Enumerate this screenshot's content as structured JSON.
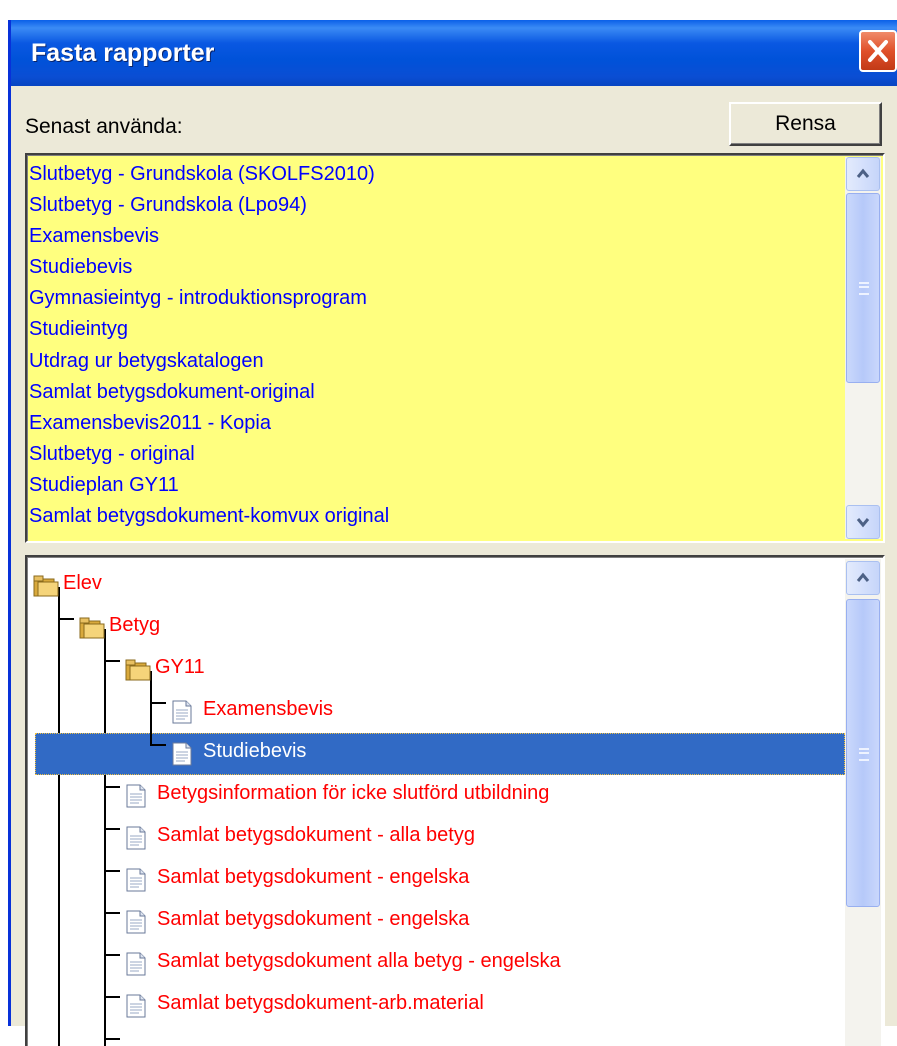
{
  "window": {
    "title": "Fasta rapporter",
    "close_icon": "close-icon"
  },
  "recent": {
    "label": "Senast använda:",
    "clear_button": "Rensa",
    "background": "#ffff7f",
    "text_color": "#0000ff",
    "items": [
      "Slutbetyg - Grundskola (SKOLFS2010)",
      "Slutbetyg - Grundskola (Lpo94)",
      "Examensbevis",
      "Studiebevis",
      "Gymnasieintyg - introduktionsprogram",
      "Studieintyg",
      "Utdrag ur betygskatalogen",
      "Samlat betygsdokument-original",
      "Examensbevis2011 - Kopia",
      "Slutbetyg - original",
      "Studieplan GY11",
      "Samlat betygsdokument-komvux original"
    ]
  },
  "tree": {
    "text_color": "#ff0000",
    "selected_background": "#316ac5",
    "nodes": [
      {
        "label": "Elev",
        "icon": "folder-icon"
      },
      {
        "label": "Betyg",
        "icon": "folder-icon"
      },
      {
        "label": "GY11",
        "icon": "folder-icon"
      },
      {
        "label": "Examensbevis",
        "icon": "document-icon"
      },
      {
        "label": "Studiebevis",
        "icon": "document-icon",
        "selected": true
      },
      {
        "label": "Betygsinformation för icke slutförd utbildning",
        "icon": "document-icon"
      },
      {
        "label": "Samlat betygsdokument - alla betyg",
        "icon": "document-icon"
      },
      {
        "label": "Samlat betygsdokument - engelska",
        "icon": "document-icon"
      },
      {
        "label": "Samlat betygsdokument - engelska",
        "icon": "document-icon"
      },
      {
        "label": "Samlat betygsdokument alla betyg - engelska",
        "icon": "document-icon"
      },
      {
        "label": "Samlat betygsdokument-arb.material",
        "icon": "document-icon"
      }
    ]
  }
}
